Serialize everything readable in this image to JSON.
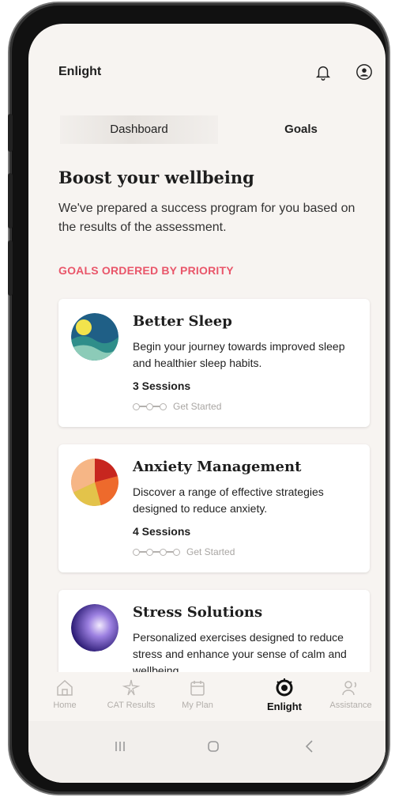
{
  "app": {
    "title": "Enlight"
  },
  "tabs": [
    {
      "label": "Dashboard"
    },
    {
      "label": "Goals"
    }
  ],
  "page": {
    "heading": "Boost your wellbeing",
    "intro": "We've prepared a success program for you based on the results of the assessment.",
    "section_title": "GOALS ORDERED BY PRIORITY"
  },
  "goals": [
    {
      "title": "Better Sleep",
      "description": "Begin your journey towards improved sleep and healthier sleep habits.",
      "sessions": "3 Sessions",
      "progress_label": "Get Started"
    },
    {
      "title": "Anxiety Management",
      "description": "Discover a range of effective strategies designed to reduce anxiety.",
      "sessions": "4 Sessions",
      "progress_label": "Get Started"
    },
    {
      "title": "Stress Solutions",
      "description": "Personalized exercises designed to reduce stress and enhance your sense of calm and wellbeing."
    }
  ],
  "nav": [
    {
      "label": "Home",
      "icon": "home-icon"
    },
    {
      "label": "CAT Results",
      "icon": "sparkle-icon"
    },
    {
      "label": "My Plan",
      "icon": "calendar-icon"
    },
    {
      "label": "Enlight",
      "icon": "enlight-logo-icon"
    },
    {
      "label": "Assistance",
      "icon": "assistance-icon"
    }
  ],
  "colors": {
    "accent": "#e9566a",
    "background": "#f7f4f1"
  }
}
